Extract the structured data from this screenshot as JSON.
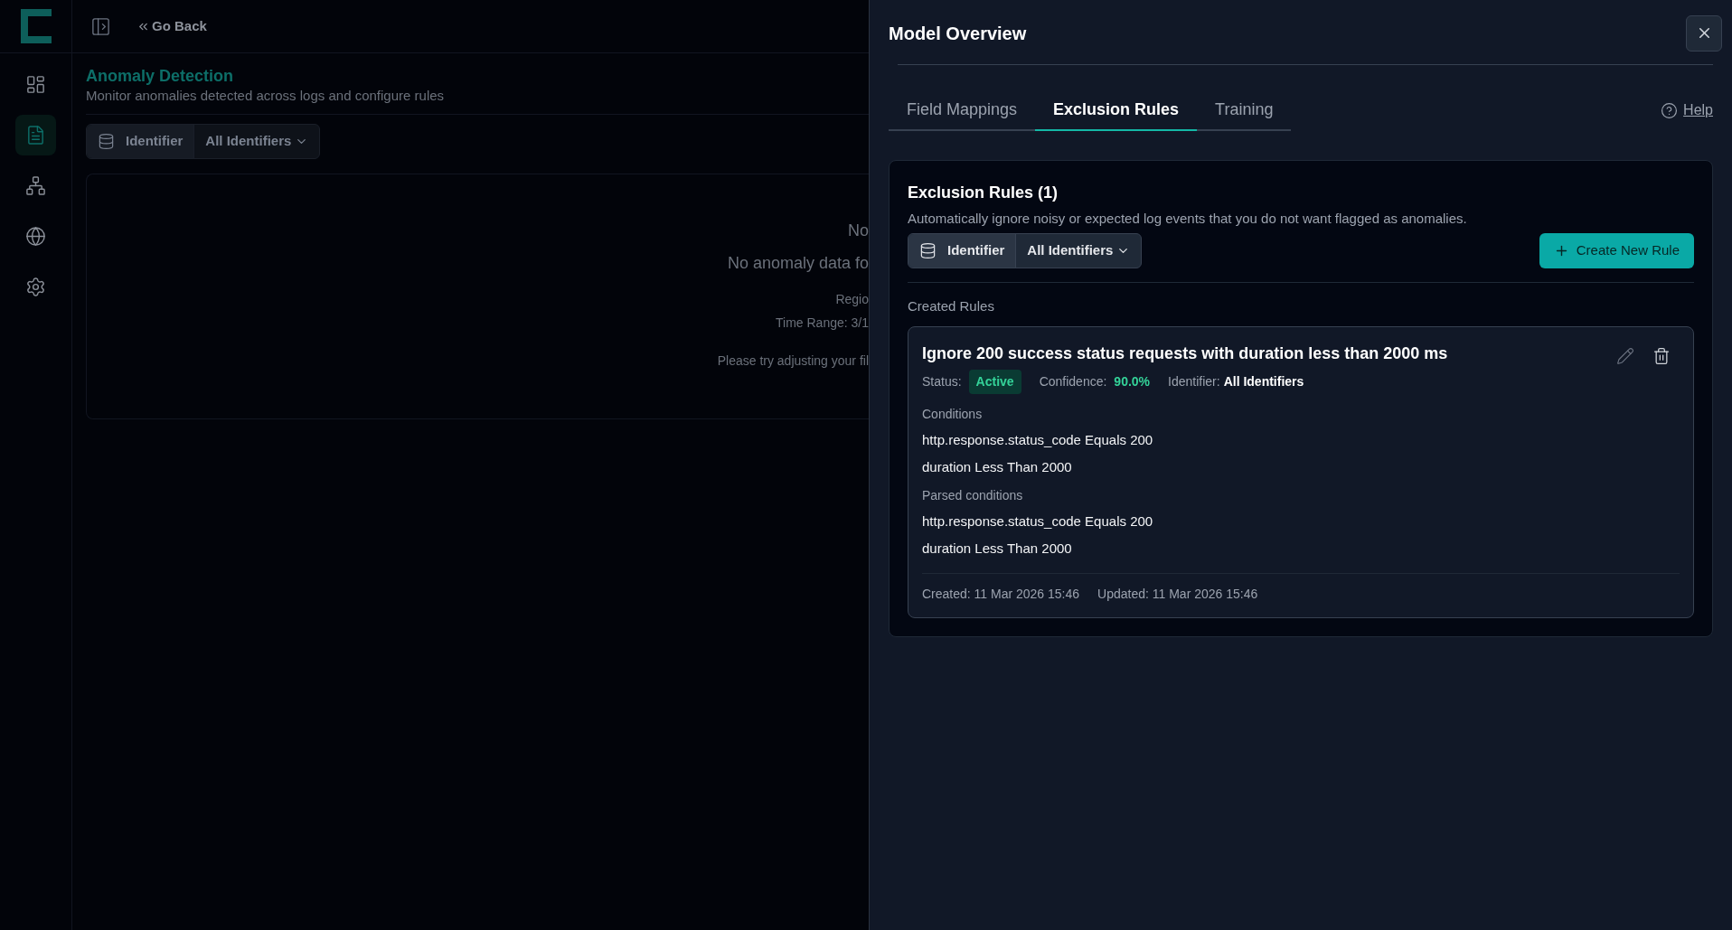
{
  "sidebar": {
    "items": [
      {
        "kind": "dashboard",
        "selected": false
      },
      {
        "kind": "document",
        "selected": true
      },
      {
        "kind": "network",
        "selected": false
      },
      {
        "kind": "globe",
        "selected": false
      },
      {
        "kind": "settings",
        "selected": false
      }
    ]
  },
  "header": {
    "back_link": "Go Back"
  },
  "page": {
    "title": "Anomaly Detection",
    "subtitle": "Monitor anomalies detected across logs and configure rules",
    "filter": {
      "label": "Identifier",
      "value": "All Identifiers"
    },
    "empty_state": {
      "heading": "No",
      "message": "No anomaly data fo",
      "region": "Regio",
      "time_range": "Time Range: 3/1",
      "hint": "Please try adjusting your fil"
    }
  },
  "drawer": {
    "title": "Model Overview",
    "tabs": [
      {
        "label": "Field Mappings",
        "selected": false
      },
      {
        "label": "Exclusion Rules",
        "selected": true
      },
      {
        "label": "Training",
        "selected": false
      }
    ],
    "help": "Help",
    "section": {
      "title": "Exclusion Rules (1)",
      "description": "Automatically ignore noisy or expected log events that you do not want flagged as anomalies.",
      "filter": {
        "label": "Identifier",
        "value": "All Identifiers"
      },
      "create_button": "Create New Rule",
      "created_label": "Created Rules",
      "rules": [
        {
          "title": "Ignore 200 success status requests with duration less than 2000 ms",
          "status_label": "Status:",
          "status": "Active",
          "active": true,
          "confidence_label": "Confidence:",
          "confidence": "90.0%",
          "identifier_label": "Identifier:",
          "identifier": "All Identifiers",
          "conditions_label": "Conditions",
          "conditions": [
            "http.response.status_code Equals 200",
            "duration Less Than 2000"
          ],
          "parsed_label": "Parsed conditions",
          "parsed": [
            "http.response.status_code Equals 200",
            "duration Less Than 2000"
          ],
          "created": "Created: 11 Mar 2026 15:46",
          "updated": "Updated: 11 Mar 2026 15:46"
        }
      ]
    }
  }
}
